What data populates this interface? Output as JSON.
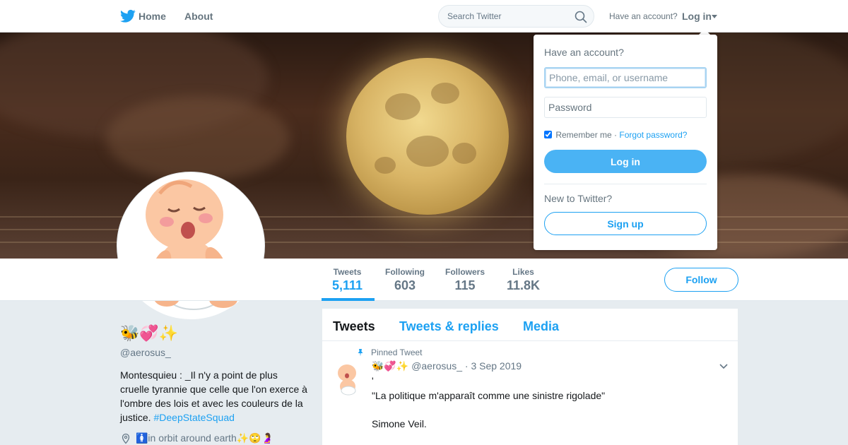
{
  "nav": {
    "home_label": "Home",
    "about_label": "About",
    "search_placeholder": "Search Twitter",
    "have_account": "Have an account?",
    "login_label": "Log in",
    "brand_color": "#1da1f2"
  },
  "profile": {
    "display_name": "🐝💞✨",
    "screen_name": "@aerosus_",
    "bio_text": "Montesquieu : _Il n'y a point de plus cruelle tyrannie que celle que l'on exerce à l'ombre des lois et avec les couleurs de la justice. ",
    "bio_hashtag": "#DeepStateSquad",
    "location": "🚺in orbit around earth✨🙄🤰",
    "follow_label": "Follow"
  },
  "stats": [
    {
      "label": "Tweets",
      "value": "5,111",
      "active": true
    },
    {
      "label": "Following",
      "value": "603"
    },
    {
      "label": "Followers",
      "value": "115"
    },
    {
      "label": "Likes",
      "value": "11.8K"
    }
  ],
  "timeline": {
    "tabs": [
      "Tweets",
      "Tweets & replies",
      "Media"
    ],
    "pinned_label": "Pinned Tweet",
    "tweet": {
      "name": "🐝💞✨",
      "handle": "@aerosus_",
      "date": "3 Sep 2019",
      "lines": [
        "'",
        "\"La politique m'apparaît comme une sinistre rigolade\"",
        "Simone Veil."
      ]
    }
  },
  "login_dropdown": {
    "title": "Have an account?",
    "username_placeholder": "Phone, email, or username",
    "password_placeholder": "Password",
    "remember_label": "Remember me",
    "separator": "·",
    "forgot_label": "Forgot password?",
    "login_button": "Log in",
    "new_label": "New to Twitter?",
    "signup_button": "Sign up"
  }
}
